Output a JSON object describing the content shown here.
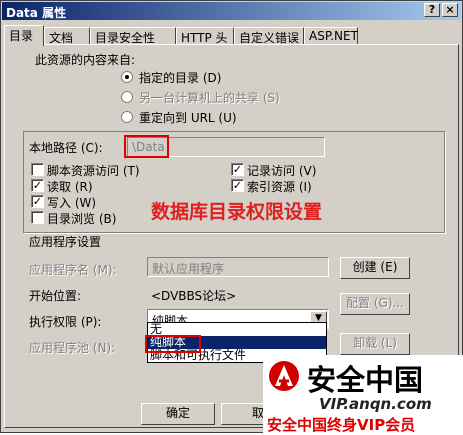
{
  "window": {
    "title": "Data 属性",
    "help_btn": "?",
    "close_btn": "×"
  },
  "tabs": [
    "目录",
    "文档",
    "目录安全性",
    "HTTP 头",
    "自定义错误",
    "ASP.NET"
  ],
  "content_source": {
    "heading": "此资源的内容来自:",
    "options": [
      {
        "label": "指定的目录 (D)",
        "selected": true,
        "enabled": true
      },
      {
        "label": "另一台计算机上的共享 (S)",
        "selected": false,
        "enabled": false
      },
      {
        "label": "重定向到 URL (U)",
        "selected": false,
        "enabled": true
      }
    ]
  },
  "local_path": {
    "label": "本地路径 (C):",
    "value": "\\Data"
  },
  "permissions": [
    {
      "label": "脚本资源访问 (T)",
      "checked": false
    },
    {
      "label": "记录访问 (V)",
      "checked": true
    },
    {
      "label": "读取 (R)",
      "checked": true
    },
    {
      "label": "索引资源 (I)",
      "checked": true
    },
    {
      "label": "写入 (W)",
      "checked": true
    },
    {
      "label": "目录浏览 (B)",
      "checked": false
    }
  ],
  "annotation": "数据库目录权限设置",
  "app_settings": {
    "heading": "应用程序设置",
    "app_name_label": "应用程序名 (M):",
    "app_name_value": "默认应用程序",
    "create_button": "创建 (E)",
    "start_label": "开始位置:",
    "start_value": "<DVBBS论坛>",
    "config_button": "配置 (G)...",
    "exec_label": "执行权限 (P):",
    "exec_value": "纯脚本",
    "exec_options": [
      "无",
      "纯脚本",
      "脚本和可执行文件"
    ],
    "unload_button": "卸载 (L)",
    "pool_label": "应用程序池 (N):"
  },
  "footer": {
    "ok": "确定",
    "cancel": "取"
  },
  "watermark": {
    "brand": "安全中国",
    "url": "VIP.anqn.com",
    "slogan": "安全中国终身VIP会员"
  },
  "colors": {
    "titlebar": "#0a246a",
    "annotation": "#e02020",
    "highlight": "#e00000",
    "slogan": "#e00000"
  }
}
